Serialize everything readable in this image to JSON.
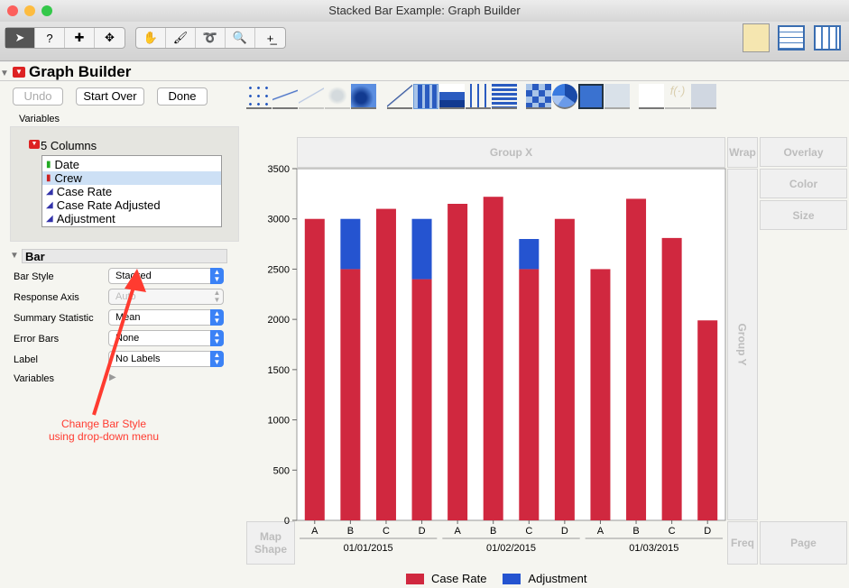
{
  "window": {
    "title": "Stacked Bar Example: Graph Builder"
  },
  "toolbar": {
    "tools": [
      "arrow-icon",
      "help-icon",
      "crosshair-icon",
      "move-icon",
      "hand-icon",
      "brush-icon",
      "lasso-icon",
      "magnifier-icon",
      "annotate-icon"
    ]
  },
  "panel": {
    "title": "Graph Builder",
    "undo": "Undo",
    "start_over": "Start Over",
    "done": "Done",
    "variables_label": "Variables",
    "columns_header": "5 Columns",
    "columns": [
      {
        "name": "Date",
        "type": "ordinal"
      },
      {
        "name": "Crew",
        "type": "nominal",
        "selected": true
      },
      {
        "name": "Case Rate",
        "type": "continuous"
      },
      {
        "name": "Case Rate Adjusted",
        "type": "continuous"
      },
      {
        "name": "Adjustment",
        "type": "continuous"
      }
    ]
  },
  "bar": {
    "header": "Bar",
    "rows": [
      {
        "label": "Bar Style",
        "value": "Stacked",
        "enabled": true
      },
      {
        "label": "Response Axis",
        "value": "Auto",
        "enabled": false
      },
      {
        "label": "Summary Statistic",
        "value": "Mean",
        "enabled": true
      },
      {
        "label": "Error Bars",
        "value": "None",
        "enabled": true
      },
      {
        "label": "Label",
        "value": "No Labels",
        "enabled": true
      }
    ],
    "variables": "Variables"
  },
  "annotation": {
    "line1": "Change Bar Style",
    "line2": "using drop-down menu",
    "color": "#ff3b30"
  },
  "zones": {
    "group_x": "Group X",
    "group_y": "Group Y",
    "wrap": "Wrap",
    "overlay": "Overlay",
    "color": "Color",
    "size": "Size",
    "map_shape": "Map Shape",
    "freq": "Freq",
    "page": "Page"
  },
  "chart_data": {
    "type": "bar",
    "stacked": true,
    "categories": [
      "A",
      "B",
      "C",
      "D",
      "A",
      "B",
      "C",
      "D",
      "A",
      "B",
      "C",
      "D"
    ],
    "groups": [
      "01/01/2015",
      "01/02/2015",
      "01/03/2015"
    ],
    "series": [
      {
        "name": "Case Rate",
        "color": "#d0283f",
        "values": [
          3000,
          2500,
          3100,
          2400,
          3150,
          3220,
          2500,
          3000,
          2500,
          3200,
          2810,
          1990
        ]
      },
      {
        "name": "Adjustment",
        "color": "#2554d0",
        "values": [
          0,
          500,
          0,
          600,
          0,
          0,
          300,
          0,
          0,
          0,
          0,
          0
        ]
      }
    ],
    "ylim": [
      0,
      3500
    ],
    "yticks": [
      "0",
      "500",
      "1000",
      "1500",
      "2000",
      "2500",
      "3000",
      "3500"
    ],
    "legend": "bottom"
  }
}
